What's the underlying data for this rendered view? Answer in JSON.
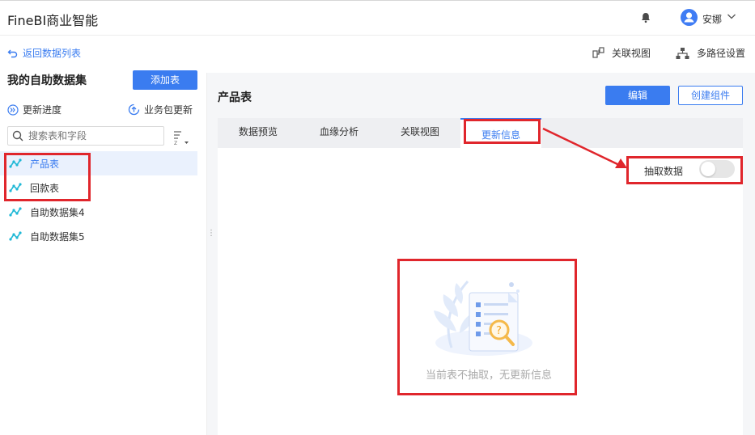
{
  "header": {
    "app_title": "FineBI商业智能",
    "user_name": "安娜",
    "icons": {
      "bell": "bell-icon",
      "avatar": "user-avatar-icon",
      "chevron": "chevron-down-icon"
    }
  },
  "toolbar": {
    "back_label": "返回数据列表",
    "relation_view_label": "关联视图",
    "multi_path_label": "多路径设置"
  },
  "sidebar": {
    "title": "我的自助数据集",
    "add_button": "添加表",
    "update_progress": "更新进度",
    "package_update": "业务包更新",
    "search_placeholder": "搜索表和字段",
    "items": [
      {
        "label": "产品表",
        "active": true
      },
      {
        "label": "回款表",
        "active": false
      },
      {
        "label": "自助数据集4",
        "active": false
      },
      {
        "label": "自助数据集5",
        "active": false
      }
    ]
  },
  "main": {
    "title": "产品表",
    "edit_button": "编辑",
    "create_button": "创建组件",
    "tabs": [
      {
        "label": "数据预览",
        "active": false
      },
      {
        "label": "血缘分析",
        "active": false
      },
      {
        "label": "关联视图",
        "active": false
      },
      {
        "label": "更新信息",
        "active": true
      }
    ],
    "extract_label": "抽取数据",
    "extract_enabled": false,
    "empty_message": "当前表不抽取，无更新信息"
  },
  "colors": {
    "accent": "#3a7cf0",
    "annotation": "#e0262c"
  }
}
